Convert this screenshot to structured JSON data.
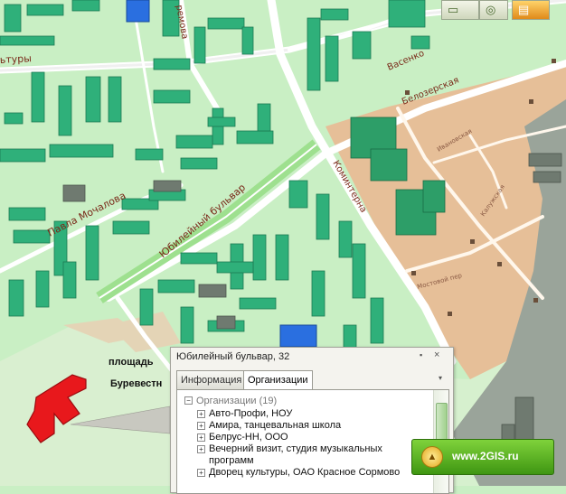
{
  "map": {
    "street_labels": {
      "kultury": "ьтуры",
      "kremova": "ремова",
      "vasenko": "Васенко",
      "belozerskaya": "Белозерская",
      "ivanovskaya": "Ивановская",
      "pavla_mochalova": "Павла Мочалова",
      "yubileyny_bulvar": "Юбилейный бульвар",
      "kominterna": "Коминтерна",
      "kaluzhskaya": "Калужская",
      "mostovoy_per": "Мостовой пер"
    },
    "place_labels": {
      "ploshchad": "площадь",
      "burevestnik": "Буревестн"
    },
    "colors": {
      "residential_area": "#c9efc4",
      "industrial_area": "#e6bf98",
      "wasteland": "#9aa49a",
      "building": "#2fb07a",
      "selected_building": "#e8181c",
      "street_label": "#7a2a1a"
    }
  },
  "toolbar": {
    "icons": [
      "ruler-icon",
      "globe-icon",
      "layers-icon"
    ]
  },
  "popup": {
    "title": "Юбилейный бульвар, 32",
    "tabs": [
      {
        "label": "Информация",
        "active": false
      },
      {
        "label": "Организации",
        "active": true
      }
    ],
    "tree_root": "Организации (19)",
    "organizations": [
      "Авто-Профи, НОУ",
      "Амира, танцевальная школа",
      "Белрус-НН, ООО",
      "Вечерний визит, студия музыкальных программ",
      "Дворец культуры, ОАО Красное Сормово"
    ]
  },
  "badge": {
    "text": "www.2GIS.ru"
  }
}
